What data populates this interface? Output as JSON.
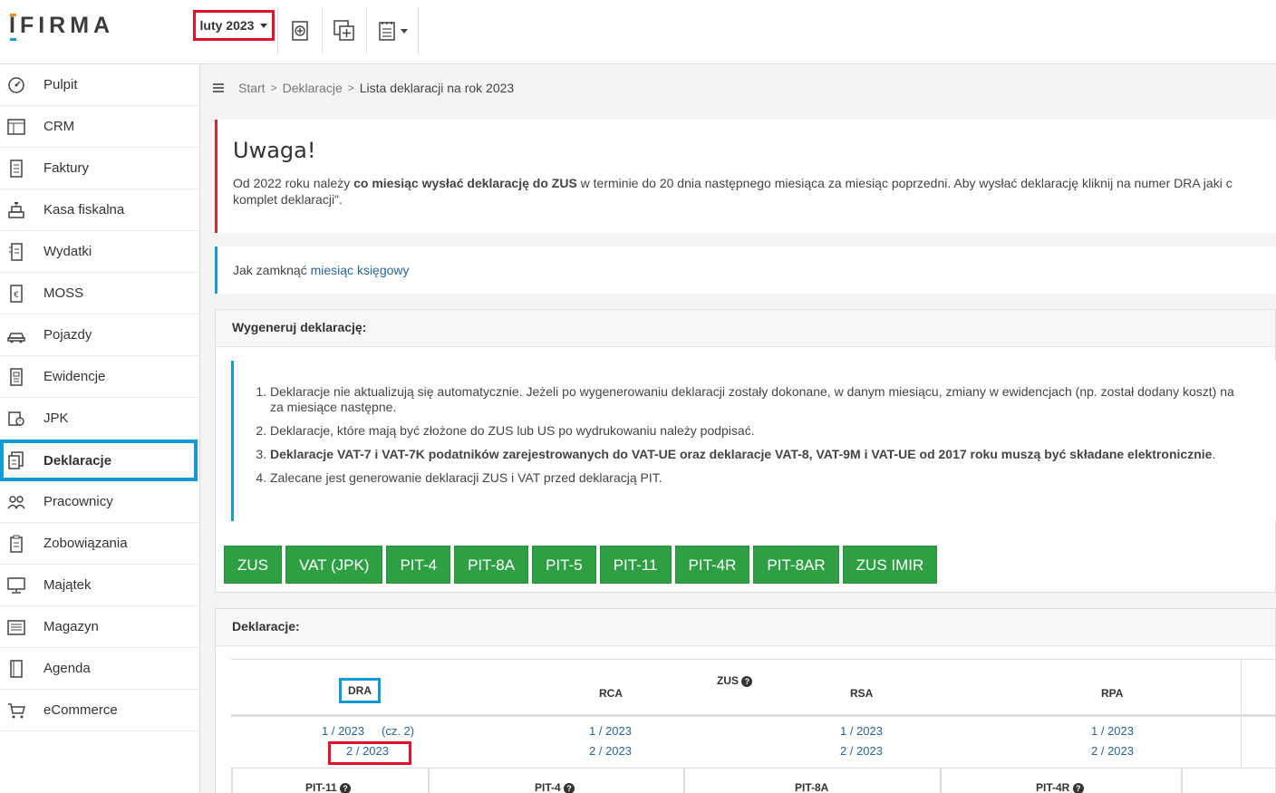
{
  "header": {
    "logo_text": "IFIRMA",
    "period_label": "luty 2023",
    "icons": [
      "add-document-icon",
      "duplicate-icon",
      "report-icon"
    ]
  },
  "sidebar": {
    "items": [
      {
        "label": "Pulpit",
        "icon": "dashboard-icon"
      },
      {
        "label": "CRM",
        "icon": "table-icon"
      },
      {
        "label": "Faktury",
        "icon": "invoice-icon"
      },
      {
        "label": "Kasa fiskalna",
        "icon": "cash-register-icon"
      },
      {
        "label": "Wydatki",
        "icon": "expenses-icon"
      },
      {
        "label": "MOSS",
        "icon": "euro-document-icon"
      },
      {
        "label": "Pojazdy",
        "icon": "car-icon"
      },
      {
        "label": "Ewidencje",
        "icon": "ledger-icon"
      },
      {
        "label": "JPK",
        "icon": "jpk-icon"
      },
      {
        "label": "Deklaracje",
        "icon": "declaration-icon",
        "active": true
      },
      {
        "label": "Pracownicy",
        "icon": "people-icon"
      },
      {
        "label": "Zobowiązania",
        "icon": "clipboard-icon"
      },
      {
        "label": "Majątek",
        "icon": "monitor-icon"
      },
      {
        "label": "Magazyn",
        "icon": "warehouse-icon"
      },
      {
        "label": "Agenda",
        "icon": "agenda-icon"
      },
      {
        "label": "eCommerce",
        "icon": "cart-icon"
      }
    ]
  },
  "breadcrumb": {
    "items": [
      "Start",
      "Deklaracje"
    ],
    "current": "Lista deklaracji na rok 2023"
  },
  "alert": {
    "title": "Uwaga!",
    "text_before": "Od 2022 roku należy ",
    "text_bold": "co miesiąc wysłać deklarację do ZUS",
    "text_after": " w terminie do 20 dnia następnego miesiąca za miesiąc poprzedni. Aby wysłać deklarację kliknij na numer DRA jaki c",
    "text_line2": "komplet deklaracji\"."
  },
  "info": {
    "text": "Jak zamknąć ",
    "link": "miesiąc księgowy"
  },
  "generate": {
    "title": "Wygeneruj deklarację:",
    "notes": {
      "n1": "Deklaracje nie aktualizują się automatycznie. Jeżeli po wygenerowaniu deklaracji zostały dokonane, w danym miesiącu, zmiany w ewidencjach (np. został dodany koszt) na",
      "n1b": "za miesiące następne.",
      "n2": "Deklaracje, które mają być złożone do ZUS lub US po wydrukowaniu należy podpisać.",
      "n3": "Deklaracje VAT-7 i VAT-7K podatników zarejestrowanych do VAT-UE oraz deklaracje VAT-8, VAT-9M i VAT-UE od 2017 roku muszą być składane elektronicznie",
      "n3end": ".",
      "n4": "Zalecane jest generowanie deklaracji ZUS i VAT przed deklaracją PIT."
    },
    "buttons": [
      "ZUS",
      "VAT (JPK)",
      "PIT-4",
      "PIT-8A",
      "PIT-5",
      "PIT-11",
      "PIT-4R",
      "PIT-8AR",
      "ZUS IMIR"
    ]
  },
  "declarations": {
    "title": "Deklaracje:",
    "zus_label": "ZUS",
    "columns": {
      "dra": "DRA",
      "rca": "RCA",
      "rsa": "RSA",
      "rpa": "RPA"
    },
    "dra": {
      "r1": "1 / 2023",
      "r1_extra": "(cz. 2)",
      "r2": "2 / 2023"
    },
    "rca": {
      "r1": "1 / 2023",
      "r2": "2 / 2023"
    },
    "rsa": {
      "r1": "1 / 2023",
      "r2": "2 / 2023"
    },
    "rpa": {
      "r1": "1 / 2023",
      "r2": "2 / 2023"
    },
    "pit_columns": [
      "PIT-11",
      "PIT-4",
      "PIT-8A",
      "PIT-4R"
    ]
  }
}
